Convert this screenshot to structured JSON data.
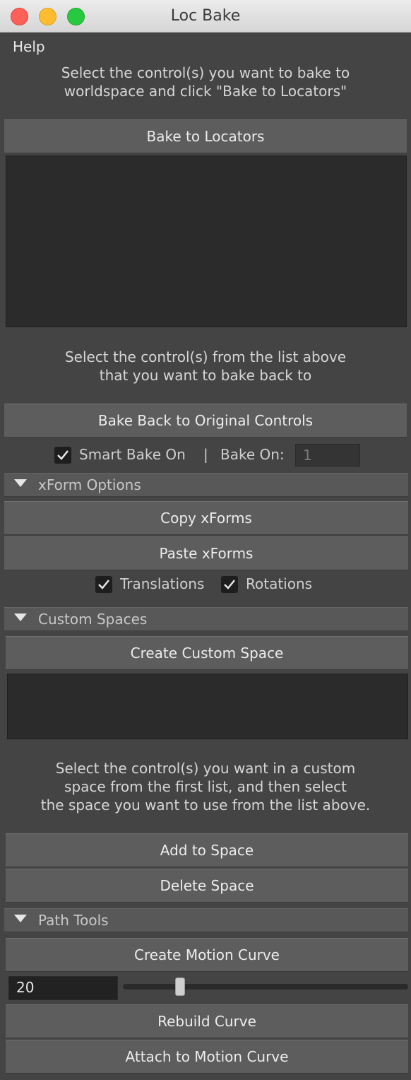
{
  "window": {
    "title": "Loc Bake"
  },
  "menubar": {
    "help": "Help"
  },
  "bake_section": {
    "instruction": "Select the control(s) you want to bake to\nworldspace and click \"Bake to Locators\"",
    "bake_button": "Bake to Locators",
    "instruction2": "Select the control(s) from the list above\nthat you want to bake back to",
    "bake_back_button": "Bake Back to Original Controls",
    "smart_bake_label": "Smart Bake On",
    "smart_bake_checked": true,
    "separator": "|",
    "bake_on_label": "Bake On:",
    "bake_on_value": "1"
  },
  "xform_options": {
    "header": "xForm Options",
    "copy_button": "Copy xForms",
    "paste_button": "Paste xForms",
    "translations_label": "Translations",
    "translations_checked": true,
    "rotations_label": "Rotations",
    "rotations_checked": true
  },
  "custom_spaces": {
    "header": "Custom Spaces",
    "create_button": "Create Custom Space",
    "instruction": "Select the control(s) you want in a custom\nspace from the first list, and then select\nthe space you want to use from the list above.",
    "add_button": "Add to Space",
    "delete_button": "Delete Space"
  },
  "path_tools": {
    "header": "Path Tools",
    "create_curve_button": "Create Motion Curve",
    "curve_value": "20",
    "rebuild_button": "Rebuild Curve",
    "attach_button": "Attach to Motion Curve"
  }
}
